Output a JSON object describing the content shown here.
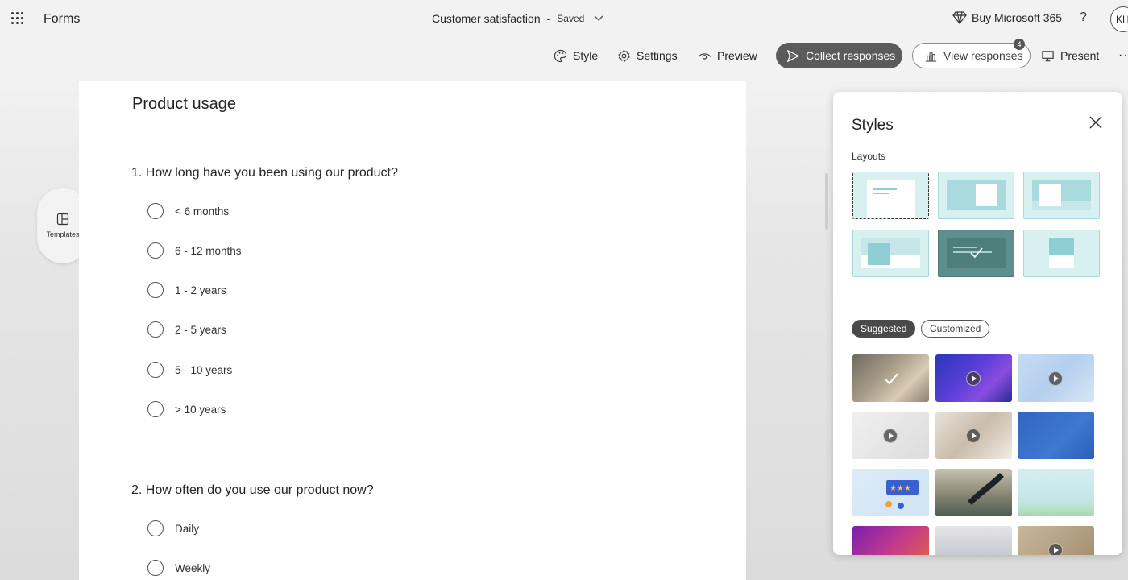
{
  "app": {
    "name": "Forms"
  },
  "document": {
    "title": "Customer satisfaction",
    "separator": "-",
    "status": "Saved"
  },
  "header": {
    "buy_label": "Buy Microsoft 365",
    "help_label": "?",
    "avatar_initials": "KH"
  },
  "toolbar": {
    "style_label": "Style",
    "settings_label": "Settings",
    "preview_label": "Preview",
    "collect_label": "Collect responses",
    "view_label": "View responses",
    "view_count": "4",
    "present_label": "Present",
    "more_label": "··"
  },
  "templates": {
    "label": "Templates"
  },
  "form": {
    "section_title": "Product usage",
    "questions": [
      {
        "label": "1. How long have you been using our product?",
        "options": [
          "< 6 months",
          "6 - 12 months",
          "1 - 2 years",
          "2 - 5 years",
          "5 - 10 years",
          "> 10 years"
        ]
      },
      {
        "label": "2. How often do you use our product now?",
        "options": [
          "Daily",
          "Weekly"
        ]
      }
    ]
  },
  "styles_panel": {
    "title": "Styles",
    "layouts_label": "Layouts",
    "tabs": {
      "suggested": "Suggested",
      "customized": "Customized"
    }
  },
  "colors": {
    "accent_dark": "#5b5b5b",
    "layout_teal": "#d9f0f1",
    "layout_selected": "#5e8f8c"
  }
}
